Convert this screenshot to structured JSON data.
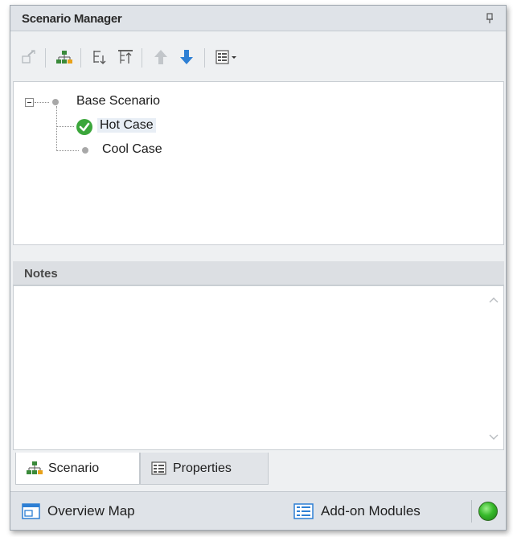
{
  "window": {
    "title": "Scenario Manager",
    "pin_icon": "pin-icon"
  },
  "toolbar": {
    "buttons": [
      {
        "icon": "new-scenario-icon",
        "enabled": false
      },
      {
        "icon": "scenario-tree-icon",
        "enabled": true
      },
      {
        "icon": "expand-tree-icon",
        "enabled": true
      },
      {
        "icon": "filter-tree-icon",
        "enabled": true
      },
      {
        "icon": "move-up-icon",
        "enabled": false
      },
      {
        "icon": "move-down-icon",
        "enabled": true
      },
      {
        "icon": "view-options-dropdown-icon",
        "enabled": true
      }
    ]
  },
  "tree": {
    "root": {
      "label": "Base Scenario",
      "expanded": true
    },
    "children": [
      {
        "label": "Hot Case",
        "selected": true,
        "status_icon": "checkmark-icon"
      },
      {
        "label": "Cool Case",
        "selected": false
      }
    ]
  },
  "notes": {
    "title": "Notes",
    "content": ""
  },
  "tabs": [
    {
      "label": "Scenario",
      "icon": "scenario-tree-icon",
      "active": true
    },
    {
      "label": "Properties",
      "icon": "properties-icon",
      "active": false
    }
  ],
  "status_bar": {
    "overview_map": "Overview Map",
    "add_on_modules": "Add-on Modules",
    "status_indicator": "green",
    "colors": {
      "indicator": "#36b92a",
      "accent_blue": "#2d7fd4"
    }
  }
}
